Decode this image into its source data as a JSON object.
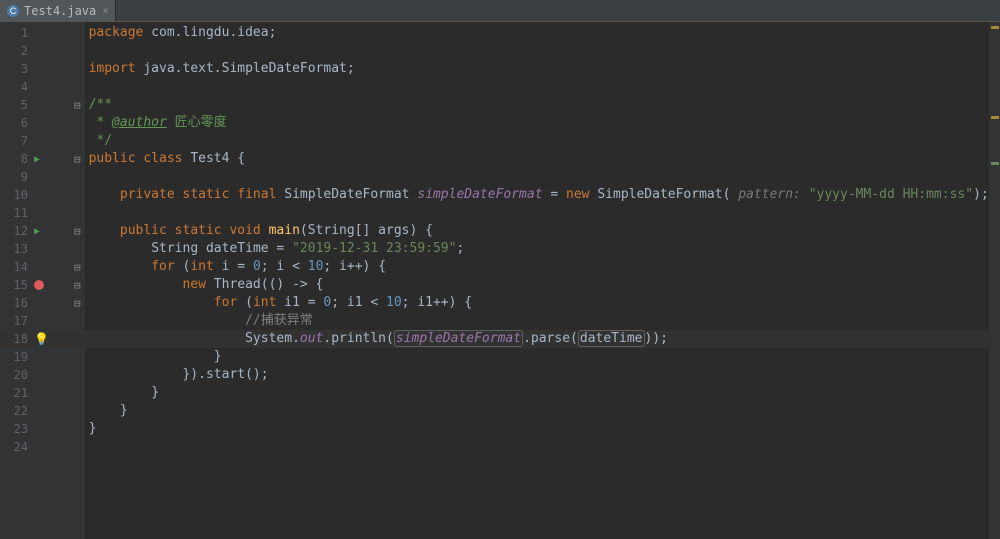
{
  "tab": {
    "filename": "Test4.java",
    "icon": "class-icon",
    "close": "×"
  },
  "line_numbers": [
    "1",
    "2",
    "3",
    "4",
    "5",
    "6",
    "7",
    "8",
    "9",
    "10",
    "11",
    "12",
    "13",
    "14",
    "15",
    "16",
    "17",
    "18",
    "19",
    "20",
    "21",
    "22",
    "23",
    "24"
  ],
  "code": {
    "l1_kw1": "package ",
    "l1_pkg": "com.lingdu.idea",
    "l1_semi": ";",
    "l3_kw1": "import ",
    "l3_pkg": "java.text.SimpleDateFormat",
    "l3_semi": ";",
    "l5_doc": "/**",
    "l6_star": " * ",
    "l6_tag": "@author",
    "l6_txt": " 匠心零度",
    "l7_doc": " */",
    "l8_kw1": "public class ",
    "l8_cls": "Test4 ",
    "l8_brace": "{",
    "l10_kw": "private static final ",
    "l10_type": "SimpleDateFormat ",
    "l10_field": "simpleDateFormat",
    "l10_eq": " = ",
    "l10_new": "new ",
    "l10_ctor": "SimpleDateFormat",
    "l10_open": "( ",
    "l10_hint": "pattern: ",
    "l10_str": "\"yyyy-MM-dd HH:mm:ss\"",
    "l10_close": ");",
    "l12_kw": "public static void ",
    "l12_m": "main",
    "l12_p": "(String[] args) {",
    "l13_type": "String ",
    "l13_var": "dateTime",
    "l13_eq": " = ",
    "l13_str": "\"2019-12-31 23:59:59\"",
    "l13_semi": ";",
    "l14_for": "for ",
    "l14_open": "(",
    "l14_int": "int ",
    "l14_v": "i = ",
    "l14_n0": "0",
    "l14_mid": "; i < ",
    "l14_n10": "10",
    "l14_post": "; i++) {",
    "l15_new": "new ",
    "l15_cls": "Thread",
    "l15_arrow": "(() -> {",
    "l16_for": "for ",
    "l16_open": "(",
    "l16_int": "int ",
    "l16_v": "i1 = ",
    "l16_n0": "0",
    "l16_mid": "; i1 < ",
    "l16_n10": "10",
    "l16_post": "; i1++) {",
    "l17_com": "//捕获异常",
    "l18_sys": "System.",
    "l18_out": "out",
    "l18_dot": ".println(",
    "l18_sdf": "simpleDateFormat",
    "l18_parse": ".parse(",
    "l18_dt": "dateTime",
    "l18_close": "));",
    "l19": "}",
    "l20": "}).start();",
    "l21": "}",
    "l22": "}",
    "l23": "}"
  }
}
